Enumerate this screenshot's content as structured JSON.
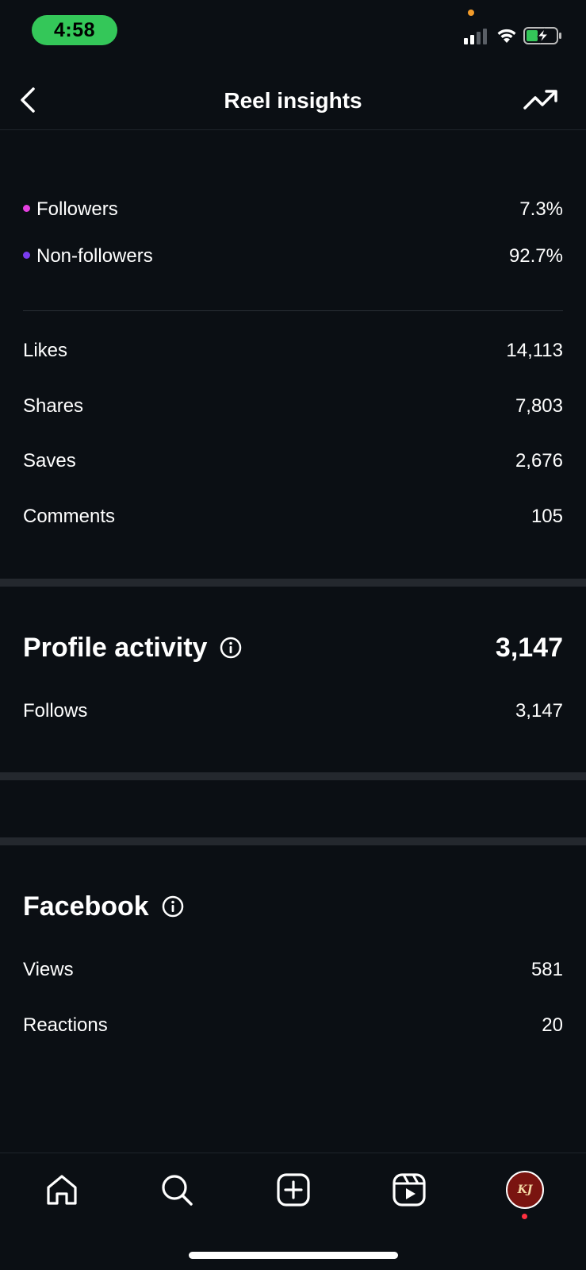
{
  "status_bar": {
    "time": "4:58",
    "pill_color": "#34c759",
    "privacy_dot_color": "#f29b2a",
    "icons": [
      "signal-icon",
      "wifi-icon",
      "battery-charging-icon"
    ]
  },
  "header": {
    "title": "Reel insights",
    "back_icon": "chevron-left-icon",
    "trend_icon": "trending-up-icon"
  },
  "audience": [
    {
      "label": "Followers",
      "value": "7.3%",
      "dot_color": "#e540e0"
    },
    {
      "label": "Non-followers",
      "value": "92.7%",
      "dot_color": "#7a3cf0"
    }
  ],
  "interactions": [
    {
      "label": "Likes",
      "value": "14,113"
    },
    {
      "label": "Shares",
      "value": "7,803"
    },
    {
      "label": "Saves",
      "value": "2,676"
    },
    {
      "label": "Comments",
      "value": "105"
    }
  ],
  "profile_activity": {
    "title": "Profile activity",
    "total": "3,147",
    "rows": [
      {
        "label": "Follows",
        "value": "3,147"
      }
    ]
  },
  "facebook": {
    "title": "Facebook",
    "rows": [
      {
        "label": "Views",
        "value": "581"
      },
      {
        "label": "Reactions",
        "value": "20"
      }
    ]
  },
  "bottom_nav": {
    "items": [
      "home-icon",
      "search-icon",
      "create-icon",
      "reels-icon",
      "profile-avatar"
    ],
    "avatar_text": "KJ",
    "notification_dot_color": "#ff3040"
  }
}
